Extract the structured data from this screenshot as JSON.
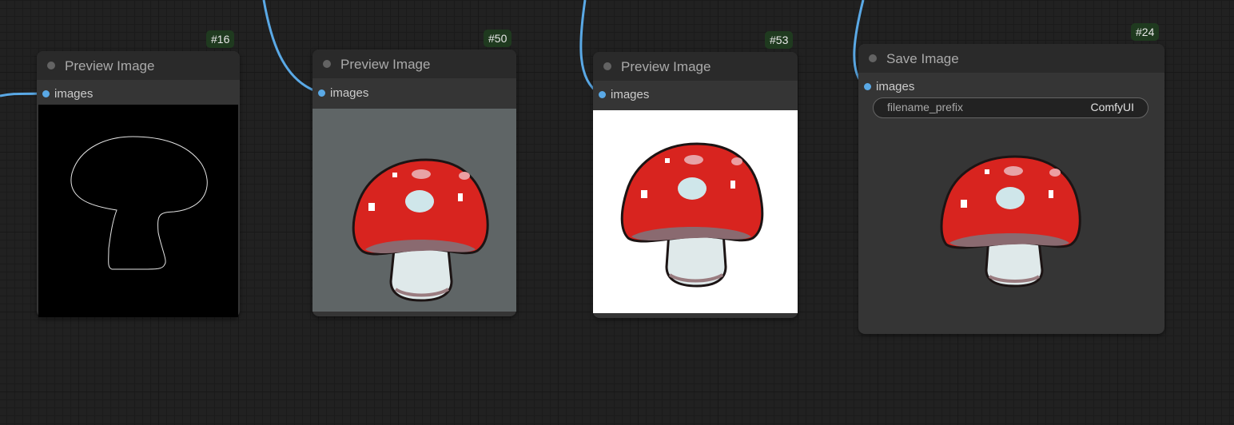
{
  "nodes": [
    {
      "id": "#16",
      "title": "Preview Image",
      "input_label": "images",
      "image": "mushroom-mask-outline-icon"
    },
    {
      "id": "#50",
      "title": "Preview Image",
      "input_label": "images",
      "image": "pixel-mushroom-gray-bg-icon"
    },
    {
      "id": "#53",
      "title": "Preview Image",
      "input_label": "images",
      "image": "pixel-mushroom-white-bg-icon"
    },
    {
      "id": "#24",
      "title": "Save Image",
      "input_label": "images",
      "widget": {
        "label": "filename_prefix",
        "value": "ComfyUI"
      },
      "image": "pixel-mushroom-transparent-icon"
    }
  ],
  "colors": {
    "canvas": "#212121",
    "node_body": "#353535",
    "node_title": "#2a2a2a",
    "wire": "#5aa9e6",
    "badge_bg": "#1f3a1f",
    "mushroom_cap": "#d8241f",
    "mushroom_spot": "#cfe6ea",
    "mushroom_stem": "#dfe9ea"
  }
}
